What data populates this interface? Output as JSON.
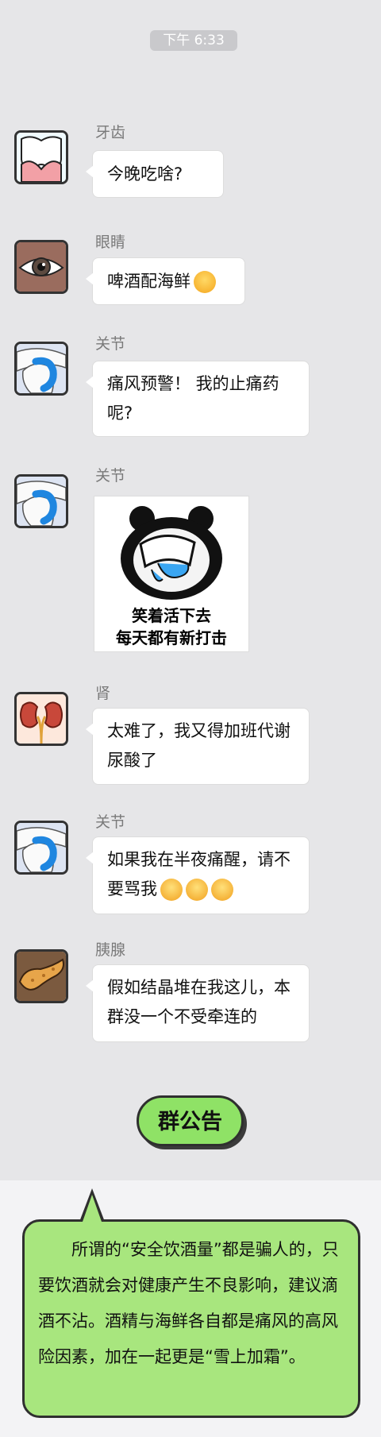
{
  "time": "下午 6:33",
  "messages": [
    {
      "sender": "牙齿",
      "text": "今晚吃啥?"
    },
    {
      "sender": "眼睛",
      "text": "啤酒配海鲜"
    },
    {
      "sender": "关节",
      "text_line1": "痛风预警！ 我的止痛药",
      "text_line2": "呢?"
    },
    {
      "sender": "关节",
      "sticker_line1": "笑着活下去",
      "sticker_line2": "每天都有新打击"
    },
    {
      "sender": "肾",
      "text_line1": "太难了，我又得加班代谢",
      "text_line2": "尿酸了"
    },
    {
      "sender": "关节",
      "text_line1": "如果我在半夜痛醒，请不",
      "text_line2": "要骂我"
    },
    {
      "sender": "胰腺",
      "text_line1": "假如结晶堆在我这儿，本",
      "text_line2": "群没一个不受牵连的"
    }
  ],
  "announcement": {
    "button": "群公告",
    "text": "所谓的“安全饮酒量”都是骗人的，只要饮酒就会对健康产生不良影响，建议滴酒不沾。酒精与海鲜各自都是痛风的高风险因素，加在一起更是“雪上加霜”。"
  },
  "icons": [
    "tooth-icon",
    "eye-icon",
    "joint-icon",
    "kidney-icon",
    "pancreas-icon",
    "smile-emoji-icon",
    "crying-emoji-icon",
    "panda-meme-sticker"
  ]
}
